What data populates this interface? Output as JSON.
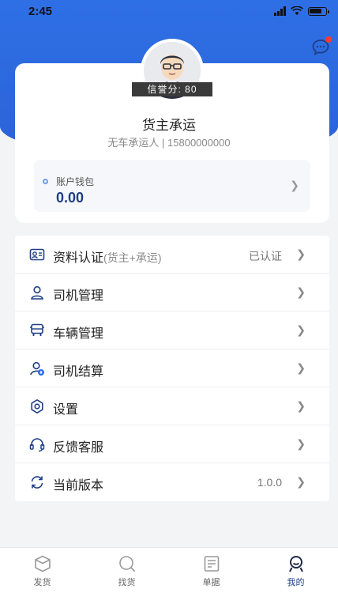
{
  "status_bar": {
    "time": "2:45"
  },
  "profile": {
    "credit_label": "信誉分: 80",
    "company": "货主承运",
    "subline": "无车承运人 | 15800000000"
  },
  "wallet": {
    "label": "账户钱包",
    "amount": "0.00"
  },
  "menu": [
    {
      "label": "资料认证",
      "sub": "(货主+承运)",
      "value": "已认证",
      "icon": "id-card-icon"
    },
    {
      "label": "司机管理",
      "sub": "",
      "value": "",
      "icon": "driver-icon"
    },
    {
      "label": "车辆管理",
      "sub": "",
      "value": "",
      "icon": "vehicle-icon"
    },
    {
      "label": "司机结算",
      "sub": "",
      "value": "",
      "icon": "settlement-icon"
    },
    {
      "label": "设置",
      "sub": "",
      "value": "",
      "icon": "gear-icon"
    },
    {
      "label": "反馈客服",
      "sub": "",
      "value": "",
      "icon": "headset-icon"
    },
    {
      "label": "当前版本",
      "sub": "",
      "value": "1.0.0",
      "icon": "refresh-icon"
    }
  ],
  "tabs": [
    {
      "label": "发货",
      "icon": "box-icon",
      "active": false
    },
    {
      "label": "找货",
      "icon": "search-icon",
      "active": false
    },
    {
      "label": "单据",
      "icon": "document-icon",
      "active": false
    },
    {
      "label": "我的",
      "icon": "user-icon",
      "active": true
    }
  ],
  "colors": {
    "primary": "#2f6fe6",
    "navy": "#1f3f86",
    "badge": "#ff3b30"
  }
}
